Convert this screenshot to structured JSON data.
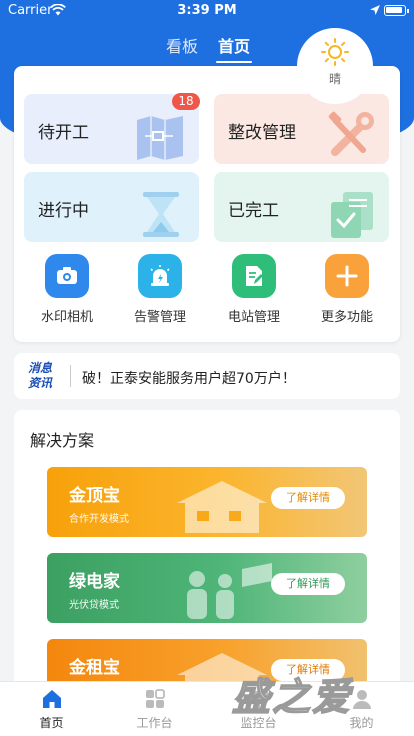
{
  "status_bar": {
    "carrier": "Carrier",
    "time": "3:39 PM"
  },
  "top_tabs": [
    {
      "label": "看板",
      "active": false
    },
    {
      "label": "首页",
      "active": true
    }
  ],
  "weather": {
    "condition": "晴",
    "icon": "sun-icon"
  },
  "tiles": [
    {
      "label": "待开工",
      "badge": "18",
      "icon": "blueprint-icon"
    },
    {
      "label": "整改管理",
      "icon": "wrench-screwdriver-icon"
    },
    {
      "label": "进行中",
      "icon": "hourglass-icon"
    },
    {
      "label": "已完工",
      "icon": "checked-document-icon"
    }
  ],
  "functions": [
    {
      "label": "水印相机",
      "icon": "camera-icon",
      "color": "#2f89ec"
    },
    {
      "label": "告警管理",
      "icon": "alarm-light-icon",
      "color": "#2bb2e8"
    },
    {
      "label": "电站管理",
      "icon": "edit-document-icon",
      "color": "#2fbd7a"
    },
    {
      "label": "更多功能",
      "icon": "plus-icon",
      "color": "#f9a23b"
    }
  ],
  "news": {
    "logo_line1": "消息",
    "logo_line2": "资讯",
    "text": "破！正泰安能服务用户超70万户！"
  },
  "solutions": {
    "title": "解决方案",
    "items": [
      {
        "name": "金顶宝",
        "subtitle": "合作开发模式",
        "button": "了解详情",
        "color": "#f7a10a"
      },
      {
        "name": "绿电家",
        "subtitle": "光伏贷模式",
        "button": "了解详情",
        "color": "#3ba061"
      },
      {
        "name": "金租宝",
        "button": "了解详情",
        "color": "#f4870e"
      }
    ]
  },
  "tabbar": [
    {
      "label": "首页",
      "icon": "home-icon",
      "active": true
    },
    {
      "label": "工作台",
      "icon": "workbench-icon",
      "active": false
    },
    {
      "label": "监控台",
      "icon": "monitor-icon",
      "active": false
    },
    {
      "label": "我的",
      "icon": "user-icon",
      "active": false
    }
  ],
  "watermark": "盛之爱",
  "colors": {
    "primary": "#1e6fe0",
    "badge": "#f0574b"
  }
}
